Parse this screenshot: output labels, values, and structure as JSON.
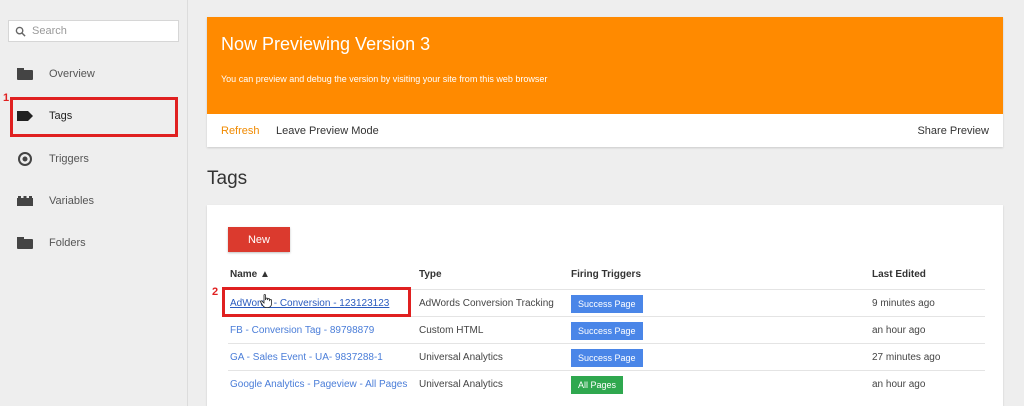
{
  "sidebar": {
    "search_placeholder": "Search",
    "items": [
      {
        "label": "Overview",
        "icon": "folder-icon"
      },
      {
        "label": "Tags",
        "icon": "tag-icon"
      },
      {
        "label": "Triggers",
        "icon": "trigger-icon"
      },
      {
        "label": "Variables",
        "icon": "variables-icon"
      },
      {
        "label": "Folders",
        "icon": "folder-icon"
      }
    ]
  },
  "annotations": {
    "step1": "1",
    "step2": "2"
  },
  "preview": {
    "title": "Now Previewing Version 3",
    "subtitle": "You can preview and debug the version by visiting your site from this web browser",
    "refresh": "Refresh",
    "leave": "Leave Preview Mode",
    "share": "Share Preview"
  },
  "section_title": "Tags",
  "tags": {
    "new_button": "New",
    "headers": {
      "name": "Name",
      "type": "Type",
      "triggers": "Firing Triggers",
      "edited": "Last Edited"
    },
    "rows": [
      {
        "name": "AdWords - Conversion - 123123123",
        "type": "AdWords Conversion Tracking",
        "trigger": "Success Page",
        "edited": "9 minutes ago"
      },
      {
        "name": "FB - Conversion Tag - 89798879",
        "type": "Custom HTML",
        "trigger": "Success Page",
        "edited": "an hour ago"
      },
      {
        "name": "GA - Sales Event - UA- 9837288-1",
        "type": "Universal Analytics",
        "trigger": "Success Page",
        "edited": "27 minutes ago"
      },
      {
        "name": "Google Analytics - Pageview - All Pages",
        "type": "Universal Analytics",
        "trigger": "All Pages",
        "edited": "an hour ago"
      }
    ]
  },
  "colors": {
    "accent_orange": "#ff8a00",
    "new_button": "#db3a2e",
    "badge_blue": "#4a86e8",
    "badge_green": "#2fa84f",
    "highlight": "#e02020"
  }
}
